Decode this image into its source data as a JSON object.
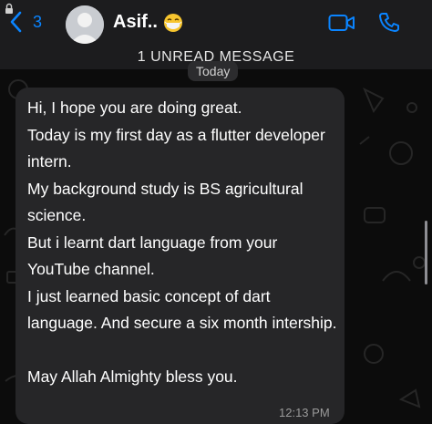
{
  "header": {
    "back_count": "3",
    "contact_name": "Asif..",
    "contact_emoji": "face-with-medical-mask-emoji"
  },
  "chat": {
    "unread_banner": "1 UNREAD MESSAGE",
    "date_label": "Today",
    "message": {
      "text": "Hi, I hope you are doing great.\nToday is my first day as a flutter developer intern.\nMy background study is BS agricultural science.\nBut i learnt dart language from your YouTube channel.\nI just learned basic concept of dart language. And secure a six month intership.\n\nMay Allah Almighty bless you.",
      "time": "12:13 PM"
    }
  },
  "colors": {
    "accent": "#0a84ff",
    "bubble": "#262628",
    "header": "#1c1c1e"
  },
  "icons": [
    "chevron-left-icon",
    "video-call-icon",
    "phone-icon",
    "lock-icon"
  ]
}
